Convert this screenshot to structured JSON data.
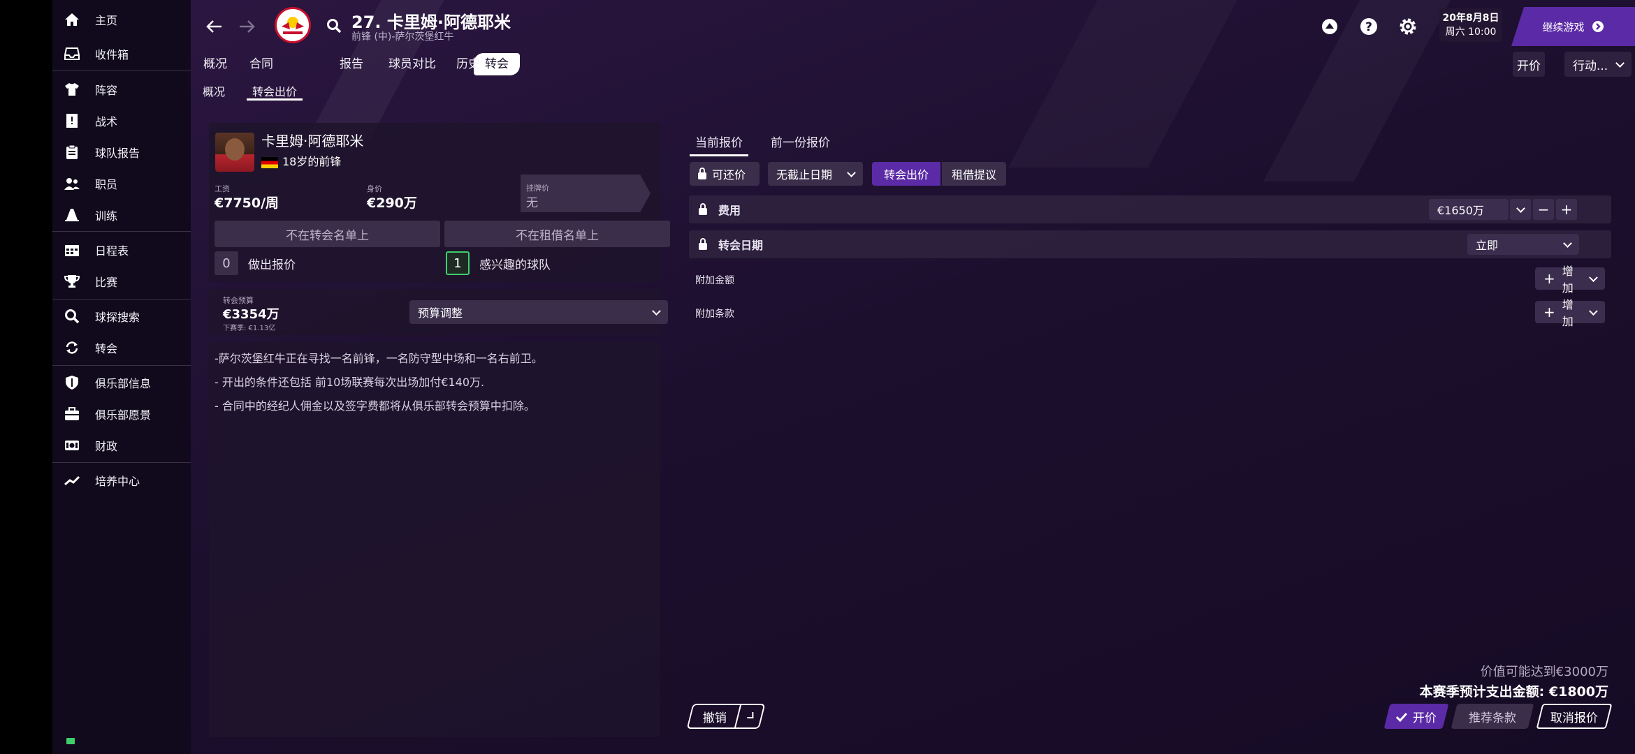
{
  "sidebar": {
    "items": [
      {
        "label": "主页",
        "icon": "home-icon"
      },
      {
        "label": "收件箱",
        "icon": "inbox-icon"
      },
      {
        "label": "阵容",
        "icon": "shirt-icon"
      },
      {
        "label": "战术",
        "icon": "tactics-board-icon"
      },
      {
        "label": "球队报告",
        "icon": "clipboard-icon"
      },
      {
        "label": "职员",
        "icon": "staff-icon"
      },
      {
        "label": "训练",
        "icon": "training-cone-icon"
      },
      {
        "label": "日程表",
        "icon": "calendar-icon"
      },
      {
        "label": "比赛",
        "icon": "trophy-icon"
      },
      {
        "label": "球探搜索",
        "icon": "search-icon"
      },
      {
        "label": "转会",
        "icon": "transfer-arrows-icon"
      },
      {
        "label": "俱乐部信息",
        "icon": "shield-icon"
      },
      {
        "label": "俱乐部愿景",
        "icon": "briefcase-icon"
      },
      {
        "label": "财政",
        "icon": "money-icon"
      },
      {
        "label": "培养中心",
        "icon": "growth-chart-icon"
      }
    ]
  },
  "header": {
    "player_title": "27. 卡里姆·阿德耶米",
    "player_subtitle": "前锋 (中)-萨尔茨堡红牛",
    "date_line1": "20年8月8日",
    "date_line2": "周六 10:00",
    "continue_label": "继续游戏"
  },
  "tabs": [
    "概况",
    "合同",
    "转会",
    "报告",
    "球员对比",
    "历史"
  ],
  "active_tab": "转会",
  "subtabs": [
    "概况",
    "转会出价"
  ],
  "actions": {
    "bid_label": "开价",
    "action_label": "行动..."
  },
  "player_card": {
    "name": "卡里姆·阿德耶米",
    "age_position": "18岁的前锋",
    "wage_label": "工资",
    "wage_value": "€7750/周",
    "value_label": "身价",
    "value_value": "€290万",
    "asking_label": "挂牌价",
    "asking_value": "无",
    "not_transfer_listed": "不在转会名单上",
    "not_loan_listed": "不在租借名单上",
    "bids_count": "0",
    "bids_label": "做出报价",
    "interested_count": "1",
    "interested_label": "感兴趣的球队"
  },
  "budget": {
    "label": "转会预算",
    "value": "€3354万",
    "next_season": "下赛季: €1.13亿",
    "adjust_label": "预算调整"
  },
  "notes": [
    "-萨尔茨堡红牛正在寻找一名前锋，一名防守型中场和一名右前卫。",
    "-  开出的条件还包括 前10场联赛每次出场加付€140万.",
    "- 合同中的经纪人佣金以及签字费都将从俱乐部转会预算中扣除。"
  ],
  "offer": {
    "tabs": [
      "当前报价",
      "前一份报价"
    ],
    "negotiable": "可还价",
    "deadline": "无截止日期",
    "type_transfer": "转会出价",
    "type_loan": "租借提议",
    "fee_label": "费用",
    "fee_value": "€1650万",
    "date_label": "转会日期",
    "date_value": "立即",
    "add_fee_label": "附加金额",
    "add_clause_label": "附加条款",
    "add_button": "增加",
    "minus": "−",
    "plus": "+"
  },
  "footer": {
    "potential_value": "价值可能达到€3000万",
    "season_spend": "本赛季预计支出金额: €1800万",
    "undo": "撤销",
    "submit": "开价",
    "suggest": "推荐条款",
    "cancel": "取消报价"
  },
  "colors": {
    "accent_purple": "#5b2aa6",
    "green": "#3ecf6a"
  }
}
